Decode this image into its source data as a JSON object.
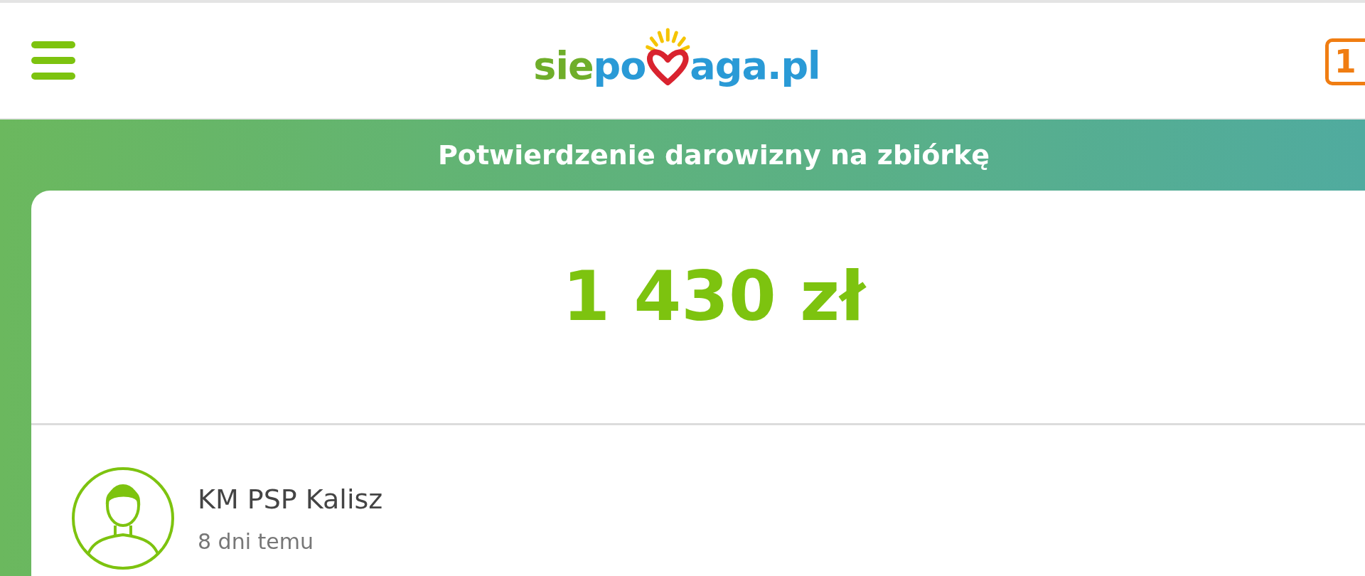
{
  "header": {
    "logo": {
      "prefix": "sie",
      "middle": "po",
      "suffix": "aga.pl"
    },
    "badge": "1"
  },
  "banner": {
    "title": "Potwierdzenie darowizny na zbiórkę"
  },
  "donation": {
    "amount": "1 430 zł",
    "donor": {
      "name": "KM PSP Kalisz",
      "time": "8 dni temu"
    }
  }
}
